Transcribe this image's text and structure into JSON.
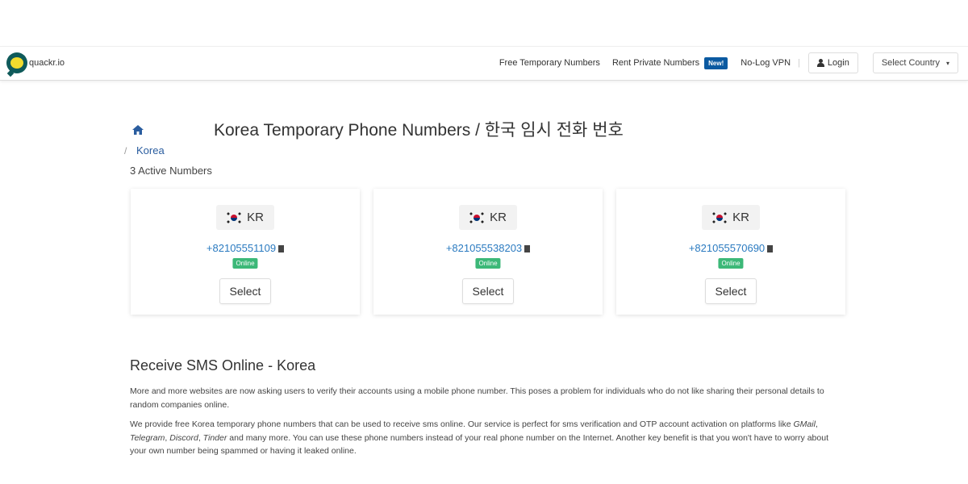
{
  "navbar": {
    "brand": "quackr.io",
    "links": [
      "Free Temporary Numbers",
      "Rent Private Numbers",
      "No-Log VPN"
    ],
    "new_badge": "New!",
    "separator": "|",
    "login": "Login",
    "select_country": "Select Country",
    "chevron": "▾"
  },
  "header": {
    "title": "Korea Temporary Phone Numbers / 한국 임시 전화 번호",
    "breadcrumb_separator": "/",
    "breadcrumb": "Korea",
    "active_numbers": "3 Active Numbers"
  },
  "cards": [
    {
      "country": "KR",
      "number": "+82105551109",
      "status": "Online",
      "button": "Select"
    },
    {
      "country": "KR",
      "number": "+821055538203",
      "status": "Online",
      "button": "Select"
    },
    {
      "country": "KR",
      "number": "+821055570690",
      "status": "Online",
      "button": "Select"
    }
  ],
  "content": {
    "heading": "Receive SMS Online - Korea",
    "p1": "More and more websites are now asking users to verify their accounts using a mobile phone number. This poses a problem for individuals who do not like sharing their personal details to random companies online.",
    "p2_a": "We provide free Korea temporary phone numbers that can be used to receive sms online. Our service is perfect for sms verification and OTP account activation on platforms like ",
    "p2_gmail": "GMail",
    "p2_telegram": "Telegram",
    "p2_discord": "Discord",
    "p2_tinder": "Tinder",
    "comma": ", ",
    "p2_b": " and many more. You can use these phone numbers instead of your real phone number on the Internet. Another key benefit is that you won't have to worry about your own number being spammed or having it leaked online."
  },
  "colors": {
    "accent": "#2a7ac0",
    "online": "#3cb878",
    "badge": "#0b5aa1"
  }
}
